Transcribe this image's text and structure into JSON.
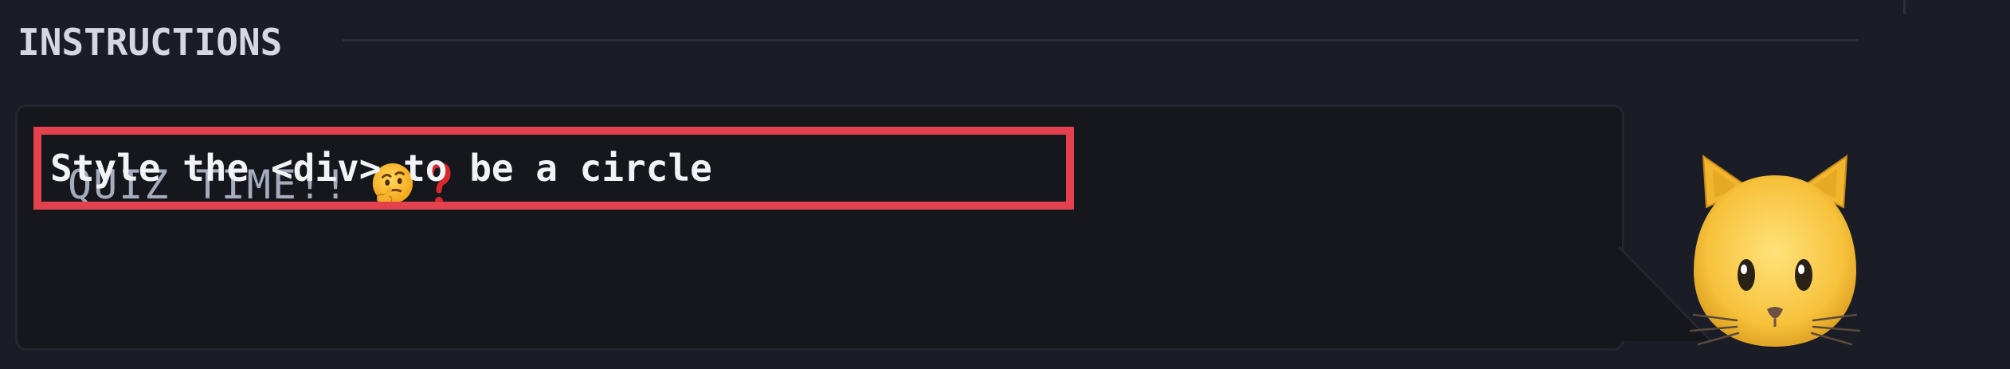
{
  "section": {
    "title": "INSTRUCTIONS"
  },
  "card": {
    "quiz_label": "QUIZ TIME!!",
    "question": "Style the <div> to be a circle"
  },
  "icons": {
    "thinking": "thinking-face-icon",
    "question_mark": "red-question-mark-icon",
    "mascot": "cat-face-icon"
  },
  "colors": {
    "background": "#1a1d26",
    "card_background": "#15171d",
    "highlight": "#e2414d",
    "quiz_text": "#a4acbd",
    "question_text": "#f2f3f6"
  }
}
